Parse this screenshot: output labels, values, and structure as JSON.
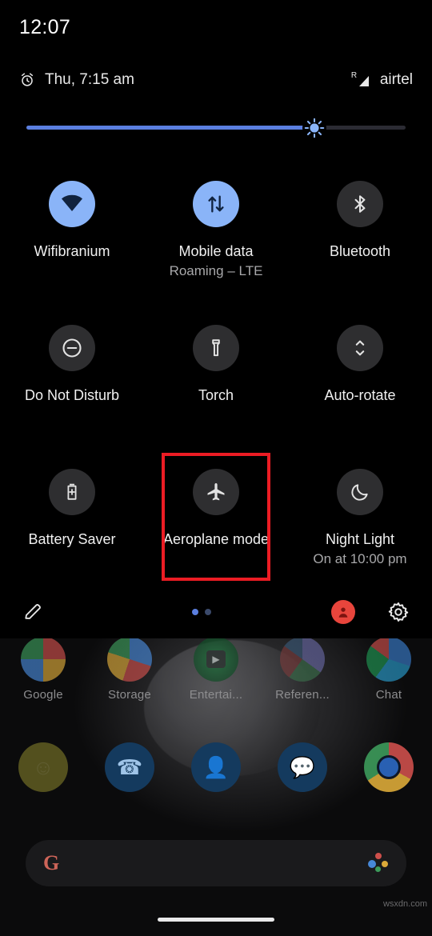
{
  "status_bar": {
    "clock": "12:07"
  },
  "quick_settings": {
    "header": {
      "alarm_icon": "alarm-clock-icon",
      "date_time": "Thu, 7:15 am",
      "signal_icon": "signal-bars-icon",
      "roaming_indicator": "R",
      "carrier": "airtel"
    },
    "brightness": {
      "name": "brightness-slider",
      "icon": "brightness-sun-icon",
      "value_percent": 76
    },
    "tiles": [
      {
        "name": "wifi",
        "icon": "wifi-icon",
        "label": "Wifibranium",
        "sub": "",
        "active": true
      },
      {
        "name": "mobile-data",
        "icon": "mobile-data-arrows-icon",
        "label": "Mobile data",
        "sub": "Roaming – LTE",
        "active": true
      },
      {
        "name": "bluetooth",
        "icon": "bluetooth-icon",
        "label": "Bluetooth",
        "sub": "",
        "active": false
      },
      {
        "name": "do-not-disturb",
        "icon": "do-not-disturb-icon",
        "label": "Do Not Disturb",
        "sub": "",
        "active": false
      },
      {
        "name": "torch",
        "icon": "flashlight-icon",
        "label": "Torch",
        "sub": "",
        "active": false
      },
      {
        "name": "auto-rotate",
        "icon": "auto-rotate-icon",
        "label": "Auto-rotate",
        "sub": "",
        "active": false
      },
      {
        "name": "battery-saver",
        "icon": "battery-saver-icon",
        "label": "Battery Saver",
        "sub": "",
        "active": false
      },
      {
        "name": "aeroplane-mode",
        "icon": "aeroplane-icon",
        "label": "Aeroplane mode",
        "sub": "",
        "active": false,
        "highlighted": true
      },
      {
        "name": "night-light",
        "icon": "moon-icon",
        "label": "Night Light",
        "sub": "On at 10:00 pm",
        "active": false
      }
    ],
    "footer": {
      "edit_icon": "pencil-edit-icon",
      "page_dots": {
        "count": 2,
        "current": 1
      },
      "user_icon": "user-avatar-icon",
      "settings_icon": "gear-settings-icon"
    }
  },
  "home_screen": {
    "folders": [
      {
        "name": "folder-google",
        "label": "Google"
      },
      {
        "name": "folder-storage",
        "label": "Storage"
      },
      {
        "name": "folder-entertainment",
        "label": "Entertai..."
      },
      {
        "name": "folder-reference",
        "label": "Referen..."
      },
      {
        "name": "folder-chat",
        "label": "Chat"
      }
    ],
    "dock": [
      {
        "name": "snapchat",
        "icon": "ghost-icon"
      },
      {
        "name": "phone",
        "icon": "phone-handset-icon"
      },
      {
        "name": "contacts",
        "icon": "person-icon"
      },
      {
        "name": "messages",
        "icon": "message-bubble-icon"
      },
      {
        "name": "chrome",
        "icon": "chrome-icon"
      }
    ],
    "search_bar": {
      "name": "google-search-bar",
      "logo": "G",
      "assistant_icon": "google-assistant-icon"
    },
    "nav_pill": "home-gesture-pill"
  },
  "watermark": "wsxdn.com"
}
